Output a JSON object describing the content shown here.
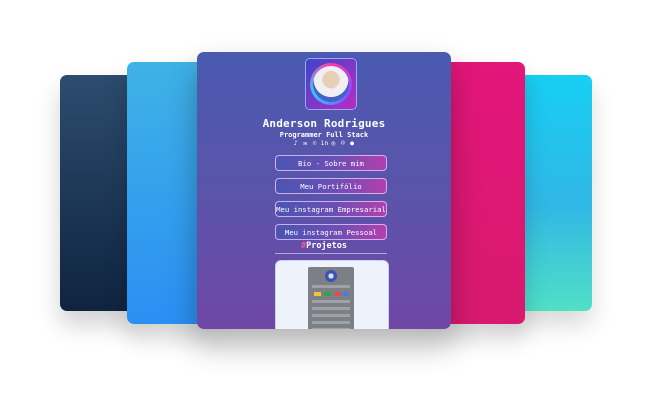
{
  "profile": {
    "name": "Anderson Rodrigues",
    "subtitle": "Programmer Full Stack"
  },
  "social_icons": [
    "tiktok-icon",
    "mail-icon",
    "whatsapp-icon",
    "linkedin-icon",
    "instagram-icon",
    "discord-icon",
    "github-icon"
  ],
  "social_glyphs": [
    "♪",
    "✉",
    "✆",
    "in",
    "◎",
    "☺",
    "●"
  ],
  "buttons": {
    "bio": "Bio - Sobre mim",
    "portfolio": "Meu Portifólio",
    "instagram_business": "Meu instagram Empresarial",
    "instagram_personal": "Meu instagram Pessoal"
  },
  "projects": {
    "hash": "#",
    "title": "Projetos"
  },
  "colors": {
    "card_navy": "#1d3758",
    "card_blue": "#2a8ff3",
    "card_main": "#5a54ab",
    "card_pink": "#e3167a",
    "card_cyan": "#17cff3",
    "accent_pink": "#ff4da8"
  }
}
